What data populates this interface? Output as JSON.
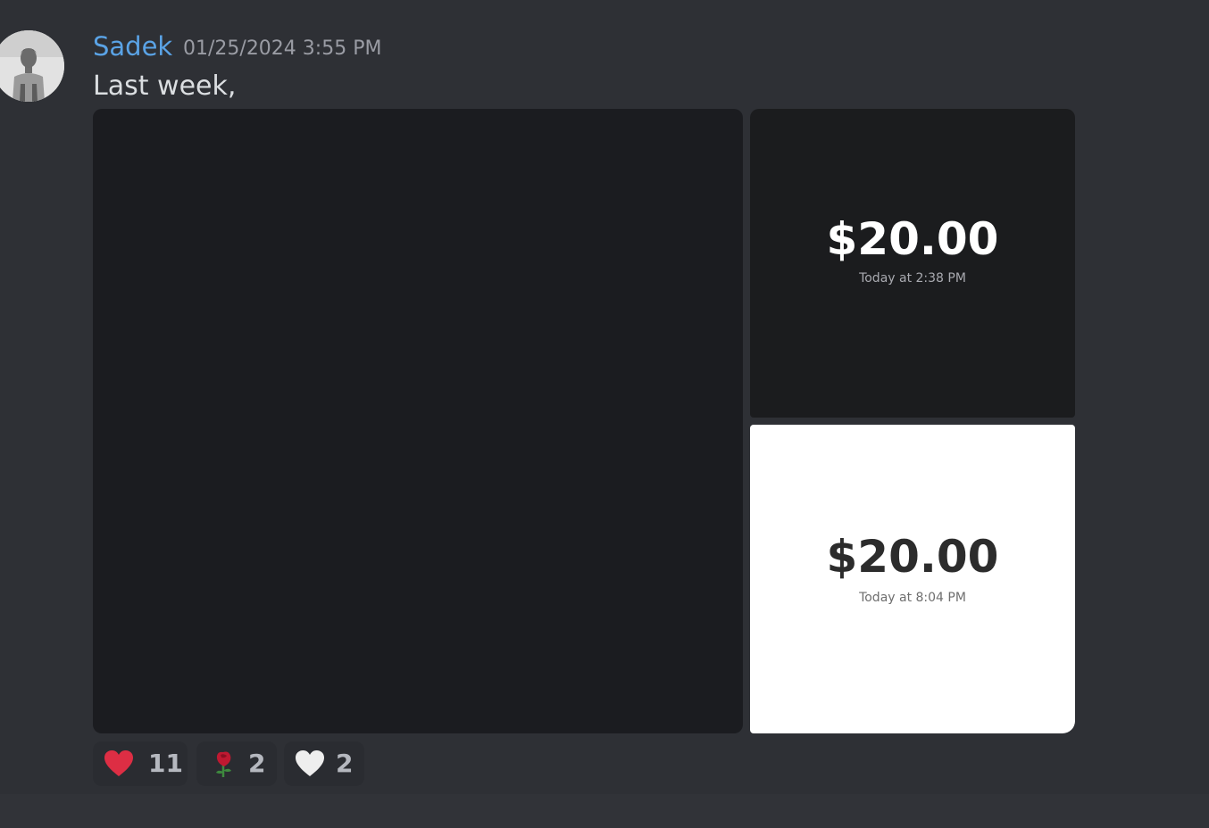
{
  "message": {
    "author": "Sadek",
    "author_color": "#5aa3e6",
    "timestamp": "01/25/2024 3:55 PM",
    "text": "Last week,"
  },
  "attachments": [
    {
      "kind": "image",
      "content": "dark-image"
    },
    {
      "kind": "payment-card",
      "theme": "dark",
      "amount": "$20.00",
      "time": "Today at 2:38 PM"
    },
    {
      "kind": "payment-card",
      "theme": "light",
      "amount": "$20.00",
      "time": "Today at 8:04 PM"
    }
  ],
  "reactions": [
    {
      "emoji": "red-heart-icon",
      "count": "11"
    },
    {
      "emoji": "rose-icon",
      "count": "2"
    },
    {
      "emoji": "white-heart-icon",
      "count": "2"
    }
  ],
  "colors": {
    "background": "#313338",
    "heart_red": "#dd2e44"
  }
}
